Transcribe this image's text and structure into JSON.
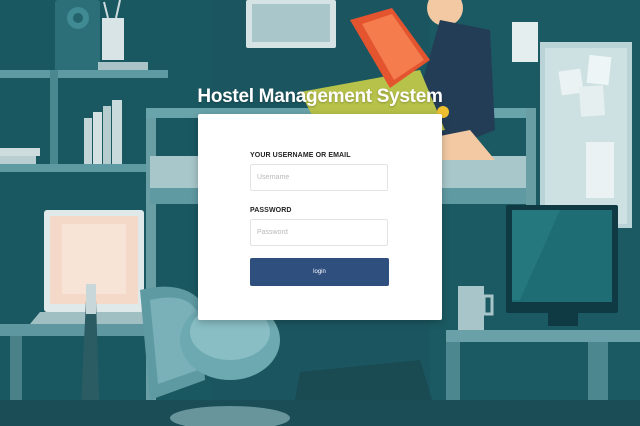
{
  "page": {
    "title": "Hostel Management System"
  },
  "login_form": {
    "username_label": "YOUR USERNAME OR EMAIL",
    "username_placeholder": "Username",
    "username_value": "",
    "password_label": "PASSWORD",
    "password_placeholder": "Password",
    "password_value": "",
    "login_button_label": "login"
  },
  "colors": {
    "background_teal": "#1c5a63",
    "button_navy": "#2f4f7f",
    "card_white": "#ffffff"
  }
}
